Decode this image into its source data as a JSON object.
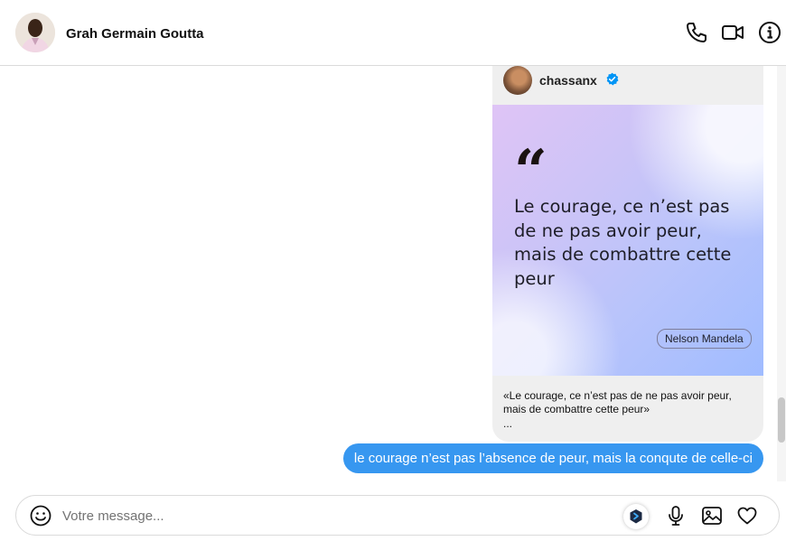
{
  "header": {
    "contact_name": "Grah Germain Goutta",
    "icons": [
      "phone-icon",
      "video-camera-icon",
      "info-icon"
    ]
  },
  "shared_post": {
    "author": "chassanx",
    "verified": true,
    "quote_mark": "“",
    "quote_text": "Le courage, ce n’est pas de ne pas avoir peur, mais de combattre cette peur",
    "quote_author": "Nelson Mandela",
    "caption": "«Le courage, ce n’est pas de ne pas avoir peur, mais de combattre cette peur»",
    "caption_more": "..."
  },
  "messages": [
    {
      "direction": "sent",
      "text": "le courage n’est pas l’absence de peur, mais la conqute de celle-ci"
    }
  ],
  "composer": {
    "placeholder": "Votre message..."
  },
  "colors": {
    "accent": "#3797f0",
    "verified": "#0095f6",
    "card_bg": "#efefef"
  }
}
